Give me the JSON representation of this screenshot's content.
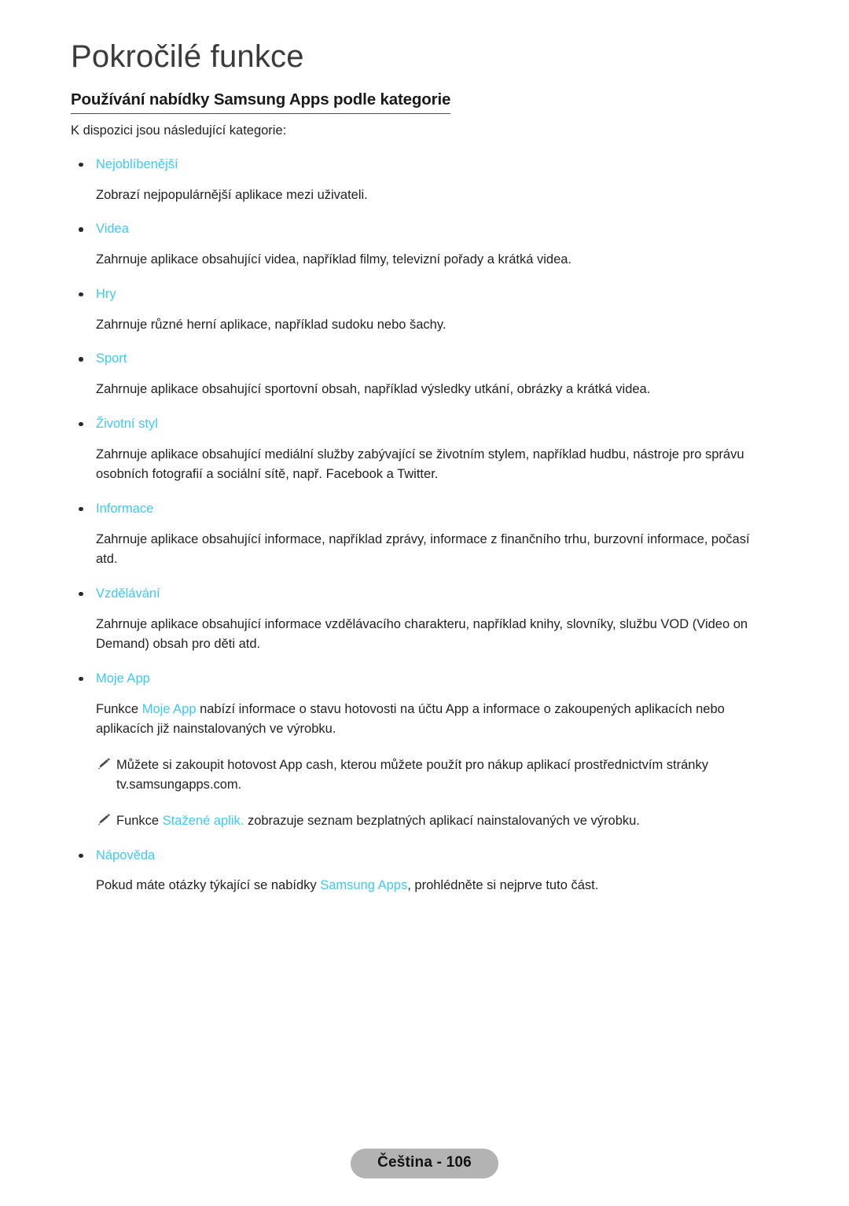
{
  "document": {
    "chapter_title": "Pokročilé funkce",
    "section_heading": "Používání nabídky Samsung Apps podle kategorie",
    "intro": "K dispozici jsou následující kategorie:",
    "accent_color": "#3ec9f0",
    "text_color": "#231f20",
    "bullet_color": "#2b2b2b"
  },
  "categories": [
    {
      "label": "Nejoblíbenější",
      "description": "Zobrazí nejpopulárnější aplikace mezi uživateli."
    },
    {
      "label": "Videa",
      "description": "Zahrnuje aplikace obsahující videa, například filmy, televizní pořady a krátká videa."
    },
    {
      "label": "Hry",
      "description": "Zahrnuje různé herní aplikace, například sudoku nebo šachy."
    },
    {
      "label": "Sport",
      "description": "Zahrnuje aplikace obsahující sportovní obsah, například výsledky utkání, obrázky a krátká videa."
    },
    {
      "label": "Životní styl",
      "description": "Zahrnuje aplikace obsahující mediální služby zabývající se životním stylem, například hudbu, nástroje pro správu osobních fotografií a sociální sítě, např. Facebook a Twitter."
    },
    {
      "label": "Informace",
      "description": "Zahrnuje aplikace obsahující informace, například zprávy, informace z finančního trhu, burzovní informace, počasí atd."
    },
    {
      "label": "Vzdělávání",
      "description": "Zahrnuje aplikace obsahující informace vzdělávacího charakteru, například knihy, slovníky, službu VOD (Video on Demand) obsah pro děti atd."
    }
  ],
  "moje_app": {
    "label": "Moje App",
    "paragraph": {
      "before": "Funkce ",
      "highlight": "Moje App",
      "after": " nabízí informace o stavu hotovosti na účtu App a informace o zakoupených aplikacích nebo aplikacích již nainstalovaných ve výrobku."
    },
    "notes": [
      {
        "icon": "pencil-note-icon",
        "before": "Můžete si zakoupit hotovost App cash, kterou můžete použít pro nákup aplikací prostřednictvím stránky tv.samsungapps.com.",
        "highlight": "",
        "after": ""
      },
      {
        "icon": "pencil-note-icon",
        "before": "Funkce ",
        "highlight": "Stažené aplik.",
        "after": " zobrazuje seznam bezplatných aplikací nainstalovaných ve výrobku."
      }
    ]
  },
  "napoveda": {
    "label": "Nápověda",
    "paragraph": {
      "before": "Pokud máte otázky týkající se nabídky ",
      "highlight": "Samsung Apps",
      "after": ", prohlédněte si nejprve tuto část."
    }
  },
  "footer": {
    "page_label": "Čeština - 106"
  }
}
